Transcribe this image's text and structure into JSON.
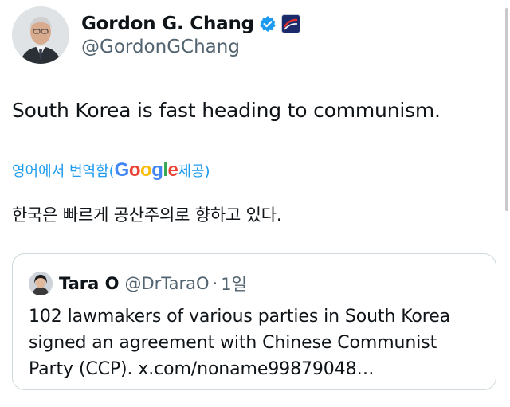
{
  "author": {
    "name": "Gordon G. Chang",
    "handle": "@GordonGChang",
    "verified_icon": "verified-badge-icon",
    "affiliation_icon": "affiliate-badge-icon"
  },
  "tweet": {
    "text": "South Korea is fast heading to communism.",
    "translate_prefix": "영어에서 번역함(",
    "translate_google": "Google",
    "translate_suffix": " 제공)",
    "translated_text": "한국은 빠르게 공산주의로 향하고 있다."
  },
  "quote": {
    "name": "Tara O",
    "handle": "@DrTaraO",
    "separator": "·",
    "time": "1일",
    "text": "102 lawmakers of various parties in South Korea signed an agreement with Chinese Communist Party (CCP). x.com/noname99879048…"
  },
  "colors": {
    "link_blue": "#1d9bf0",
    "secondary_text": "#536471",
    "border": "#cfd9de",
    "google_blue": "#4285F4",
    "google_red": "#EA4335",
    "google_yellow": "#FBBC05",
    "google_green": "#34A853"
  }
}
